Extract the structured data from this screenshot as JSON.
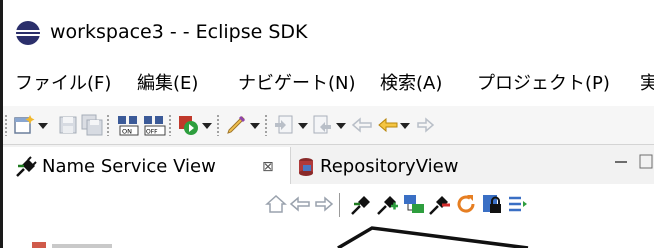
{
  "window": {
    "title": "workspace3 -  - Eclipse SDK",
    "app_icon": "eclipse-icon"
  },
  "menu": [
    {
      "label": "ファイル(F)"
    },
    {
      "label": "編集(E)"
    },
    {
      "label": "ナビゲート(N)"
    },
    {
      "label": "検索(A)"
    },
    {
      "label": "プロジェクト(P)"
    },
    {
      "label": "実"
    }
  ],
  "toolbar": {
    "icons": [
      "new-wizard-icon",
      "save-icon",
      "save-all-icon",
      "rtc-on-icon",
      "rtc-off-icon",
      "run-icon",
      "pen-icon",
      "next-annotation-icon",
      "previous-annotation-icon",
      "last-edit-icon",
      "back-icon",
      "forward-icon"
    ]
  },
  "tabs": [
    {
      "label": "Name Service View",
      "close": "⊠",
      "icon": "plug-icon"
    },
    {
      "label": "RepositoryView",
      "icon": "repository-icon"
    }
  ],
  "view_toolbar": {
    "icons": [
      "home-icon",
      "back-icon",
      "forward-icon",
      "connect-icon",
      "add-icon",
      "tree-icon",
      "delete-icon",
      "refresh-icon",
      "lock-icon",
      "filter-icon"
    ]
  },
  "colors": {
    "accent": "#2b2f6b",
    "toolbar_bg": "#f6f6f6",
    "tabbar_bg": "#f2f2f2"
  }
}
